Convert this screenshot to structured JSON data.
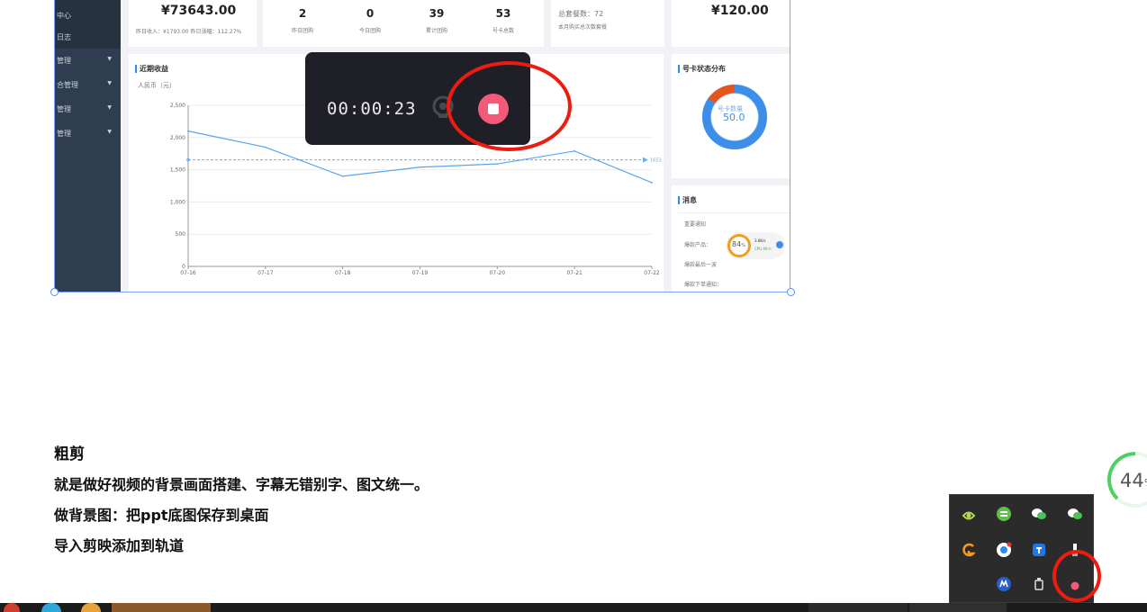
{
  "dashboard": {
    "sidebar": [
      "中心",
      "日志",
      "管理",
      "合管理",
      "管理",
      "管理"
    ],
    "revenue": {
      "total": "¥73643.00",
      "sub": "昨日收入：¥1793.00  昨日涨幅：112.27%"
    },
    "stats": [
      {
        "value": "2",
        "label": "昨日团购"
      },
      {
        "value": "0",
        "label": "今日团购"
      },
      {
        "value": "39",
        "label": "累计团购"
      },
      {
        "value": "53",
        "label": "号卡总数"
      }
    ],
    "orders": {
      "line1": "总套餐数：72",
      "line2": "本月购买总次数套餐"
    },
    "price": "¥120.00",
    "chart_title": "近期收益",
    "status_title": "号卡状态分布",
    "donut": {
      "label": "号卡数量",
      "value": "50.0"
    },
    "messages": {
      "title": "消息",
      "items": [
        "重要通知",
        "爆款产品：",
        "爆款最后一波",
        "爆款下单通知："
      ]
    },
    "widget": {
      "percent": "84",
      "unit": "%",
      "speed": "3.8K/s",
      "cpu": "CPU 46℃"
    }
  },
  "chart_data": {
    "type": "line",
    "title": "近期收益",
    "ylabel": "人民币（元）",
    "categories": [
      "07-16",
      "07-17",
      "07-18",
      "07-19",
      "07-20",
      "07-21",
      "07-22"
    ],
    "values": [
      2100,
      1850,
      1400,
      1540,
      1590,
      1790,
      1300
    ],
    "yticks": [
      "0",
      "500",
      "1,000",
      "1,500",
      "2,000",
      "2,500"
    ],
    "ylim": [
      0,
      2500
    ],
    "average": 1653.57,
    "average_label": "1653.57",
    "colors": {
      "line": "#5aa5ee",
      "avg": "#6aaef5"
    }
  },
  "recorder": {
    "time": "00:00:23"
  },
  "article": {
    "heading": "粗剪",
    "line1": "就是做好视频的背景画面搭建、字幕无错别字、图文统一。",
    "line2": "做背景图：把ppt底图保存到桌面",
    "line3": "导入剪映添加到轨道"
  },
  "badge": {
    "value": "44",
    "unit": "%"
  },
  "tray_icons": [
    "nvidia-icon",
    "app-green-icon",
    "wechat-icon",
    "wechat-icon",
    "app-orange-icon",
    "browser-icon",
    "app-blue-icon",
    "usb-icon",
    "meeting-icon",
    "usb-drive-icon",
    "recording-icon"
  ],
  "colors": {
    "accent": "#2b8cf0",
    "annotation": "#ee1b10",
    "stop": "#f35a7a"
  }
}
